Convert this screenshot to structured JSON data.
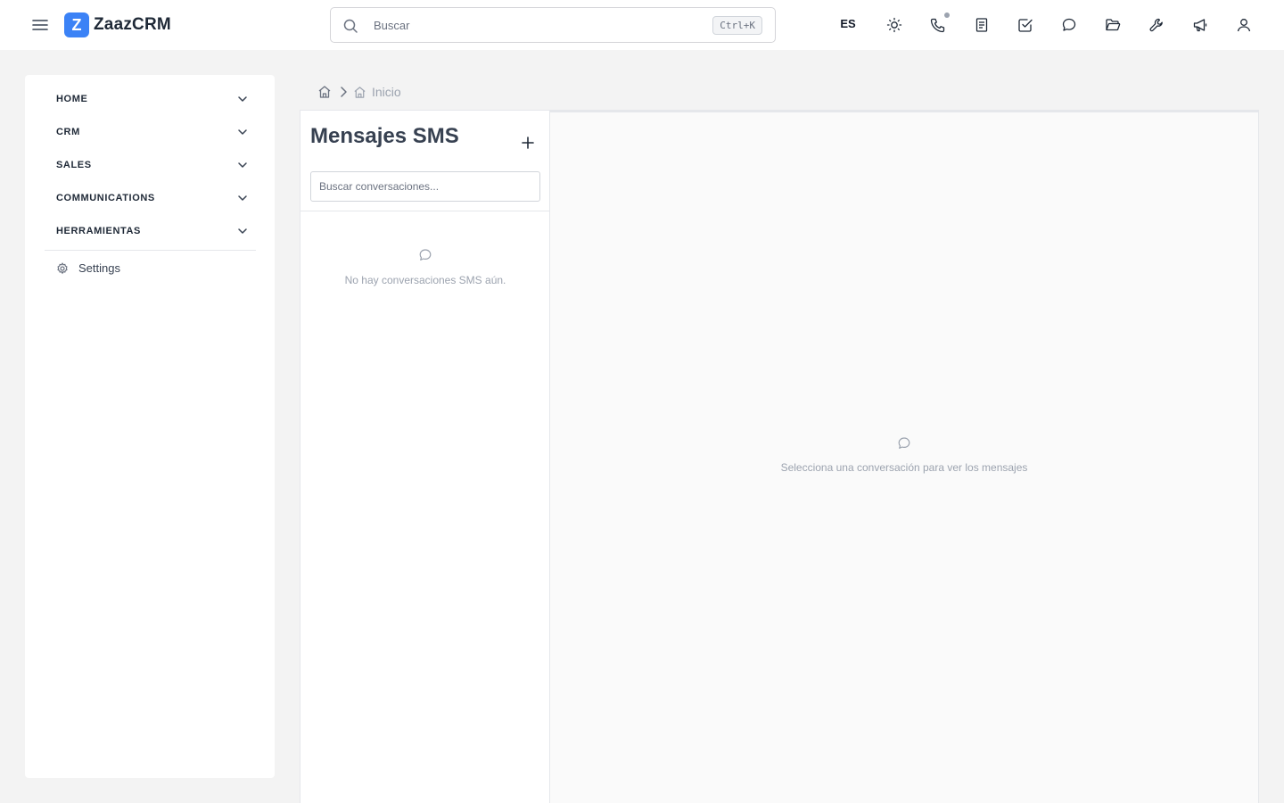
{
  "brand": {
    "logo_letter": "Z",
    "name": "ZaazCRM",
    "logo_color": "#3b82f6"
  },
  "search": {
    "placeholder": "Buscar",
    "shortcut": "Ctrl+K"
  },
  "topbar": {
    "language": "ES",
    "icons": [
      "theme-icon",
      "phone-icon",
      "notes-icon",
      "tasks-icon",
      "chat-icon",
      "folder-icon",
      "tools-icon",
      "megaphone-icon",
      "user-icon"
    ]
  },
  "sidebar": {
    "items": [
      {
        "label": "HOME"
      },
      {
        "label": "CRM"
      },
      {
        "label": "SALES"
      },
      {
        "label": "COMMUNICATIONS"
      },
      {
        "label": "HERRAMIENTAS"
      }
    ],
    "settings_label": "Settings"
  },
  "breadcrumb": {
    "current": "Inicio"
  },
  "sms": {
    "title": "Mensajes SMS",
    "search_placeholder": "Buscar conversaciones...",
    "empty_list": "No hay conversaciones SMS aún.",
    "empty_detail": "Selecciona una conversación para ver los mensajes"
  }
}
